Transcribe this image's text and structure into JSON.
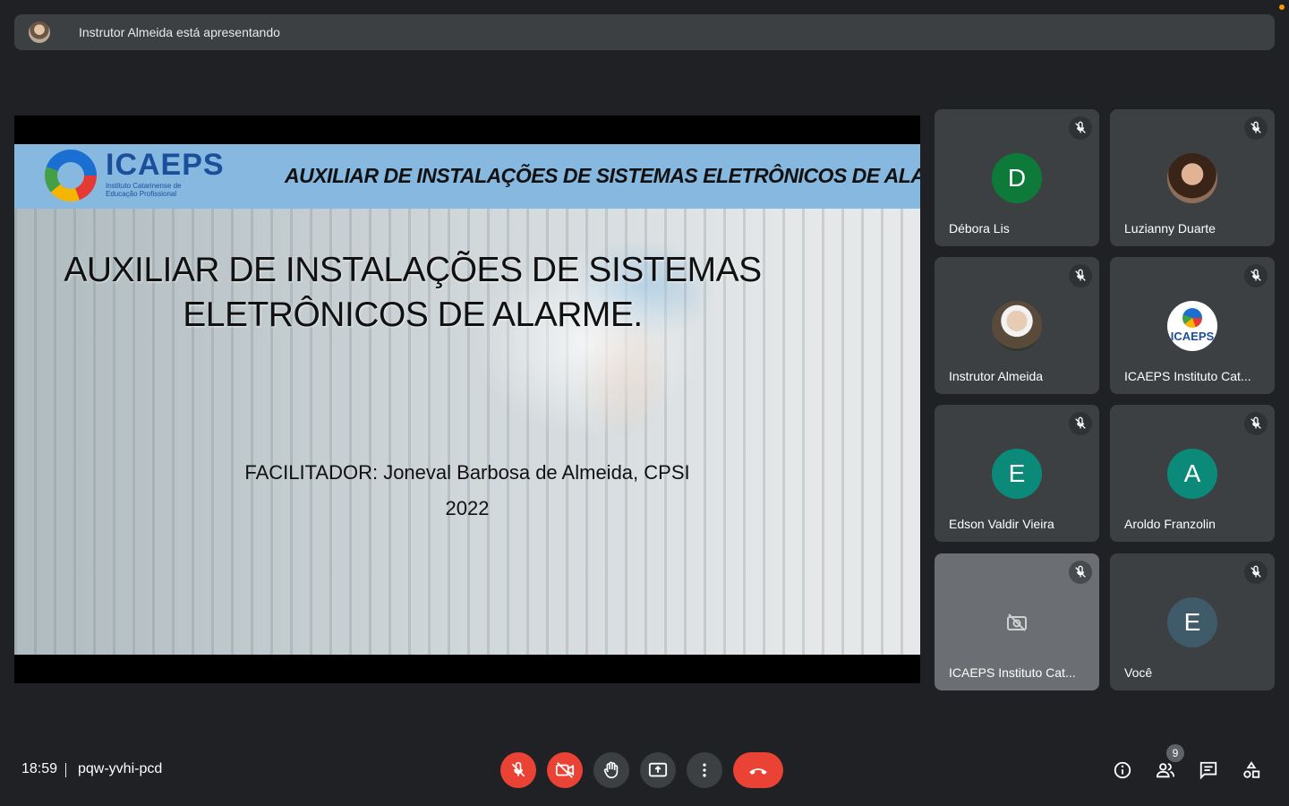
{
  "presenter_bar": {
    "text": "Instrutor Almeida está apresentando"
  },
  "slide": {
    "banner_logo_name": "ICAEPS",
    "banner_logo_subtitle": "Instituto Catarinense de Educação Profissional",
    "banner_title": "AUXILIAR DE INSTALAÇÕES DE SISTEMAS ELETRÔNICOS DE ALARME",
    "heading_line1": "AUXILIAR DE INSTALAÇÕES DE SISTEMAS",
    "heading_line2": "ELETRÔNICOS DE ALARME.",
    "facilitator": "FACILITADOR: Joneval Barbosa de Almeida, CPSI",
    "year": "2022"
  },
  "participants": [
    {
      "name": "Débora Lis",
      "initial": "D",
      "color": "#0d7a3a",
      "avatar_type": "initial",
      "mic_muted": true
    },
    {
      "name": "Luzianny Duarte",
      "initial": "",
      "avatar_type": "photo",
      "mic_muted": true
    },
    {
      "name": "Instrutor Almeida",
      "initial": "",
      "avatar_type": "photo",
      "mic_muted": true
    },
    {
      "name": "ICAEPS Instituto Cat...",
      "initial": "",
      "avatar_type": "logo",
      "logo_text": "ICAEPS",
      "mic_muted": true
    },
    {
      "name": "Edson Valdir Vieira",
      "initial": "E",
      "color": "#0b8a7a",
      "avatar_type": "initial",
      "mic_muted": true
    },
    {
      "name": "Aroldo Franzolin",
      "initial": "A",
      "color": "#0b8a7a",
      "avatar_type": "initial",
      "mic_muted": true
    },
    {
      "name": "ICAEPS Instituto Cat...",
      "initial": "",
      "avatar_type": "camera-off",
      "mic_muted": true
    },
    {
      "name": "Você",
      "initial": "E",
      "color": "#3f5a68",
      "avatar_type": "initial",
      "mic_muted": true
    }
  ],
  "bottom_bar": {
    "time": "18:59",
    "meeting_code": "pqw-yvhi-pcd",
    "participant_count": "9",
    "controls": [
      "mic-off-icon",
      "camera-off-icon",
      "raise-hand-icon",
      "present-screen-icon",
      "more-options-icon",
      "end-call-icon"
    ],
    "right_icons": [
      "info-icon",
      "people-icon",
      "chat-icon",
      "activities-icon"
    ]
  },
  "colors": {
    "background": "#202124",
    "surface": "#3c4043",
    "danger": "#ea4335",
    "slide_banner": "#86b8e0"
  }
}
